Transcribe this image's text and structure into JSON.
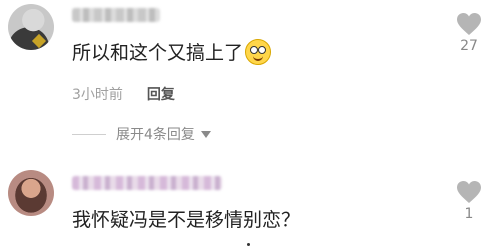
{
  "comments": [
    {
      "text": "所以和这个又搞上了",
      "emoji": "smiling-face-emoji",
      "time": "3小时前",
      "reply_label": "回复",
      "likes": "27"
    },
    {
      "text": "我怀疑冯是不是移情别恋？",
      "likes": "1"
    }
  ],
  "expand_replies": "展开4条回复",
  "colors": {
    "text": "#222222",
    "muted": "#a0a0a0",
    "like_icon": "#b5b5b5"
  }
}
